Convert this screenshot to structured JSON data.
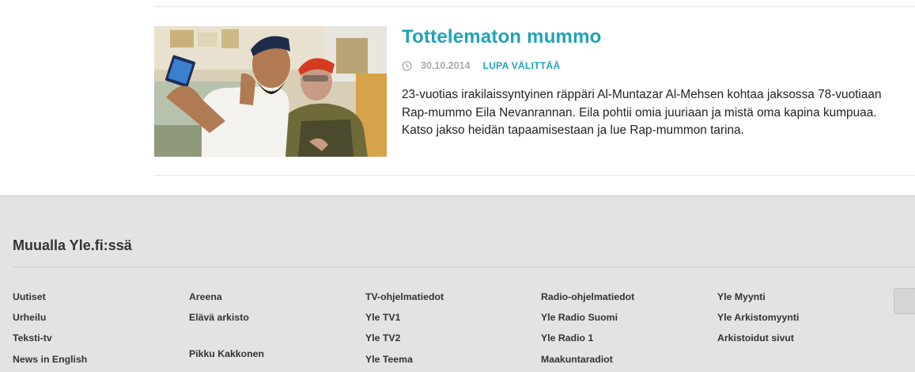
{
  "article": {
    "title": "Tottelematon mummo",
    "date": "30.10.2014",
    "category": "LUPA VÄLITTÄÄ",
    "description": "23-vuotias irakilaissyntyinen räppäri Al-Muntazar Al-Mehsen kohtaa jaksossa 78-vuotiaan Rap-mummo Eila Nevanrannan. Eila pohtii omia juuriaan ja mistä oma kapina kumpuaa. Katso jakso heidän tapaamisestaan ja lue Rap-mummon tarina."
  },
  "footer": {
    "heading": "Muualla Yle.fi:ssä",
    "columns": [
      [
        "Uutiset",
        "Urheilu",
        "Teksti-tv",
        "News in English"
      ],
      [
        "Areena",
        "Elävä arkisto",
        "Pikku Kakkonen"
      ],
      [
        "TV-ohjelmatiedot",
        "Yle TV1",
        "Yle TV2",
        "Yle Teema"
      ],
      [
        "Radio-ohjelmatiedot",
        "Yle Radio Suomi",
        "Yle Radio 1",
        "Maakuntaradiot"
      ],
      [
        "Yle Myynti",
        "Yle Arkistomyynti",
        "Arkistoidut sivut"
      ]
    ]
  },
  "colors": {
    "accent": "#1fa3b8",
    "meta_gray": "#aaaaaa",
    "footer_bg": "#e3e3e3"
  },
  "icons": {
    "meta": "clock-icon",
    "scroll": "scroll-to-top-button"
  }
}
